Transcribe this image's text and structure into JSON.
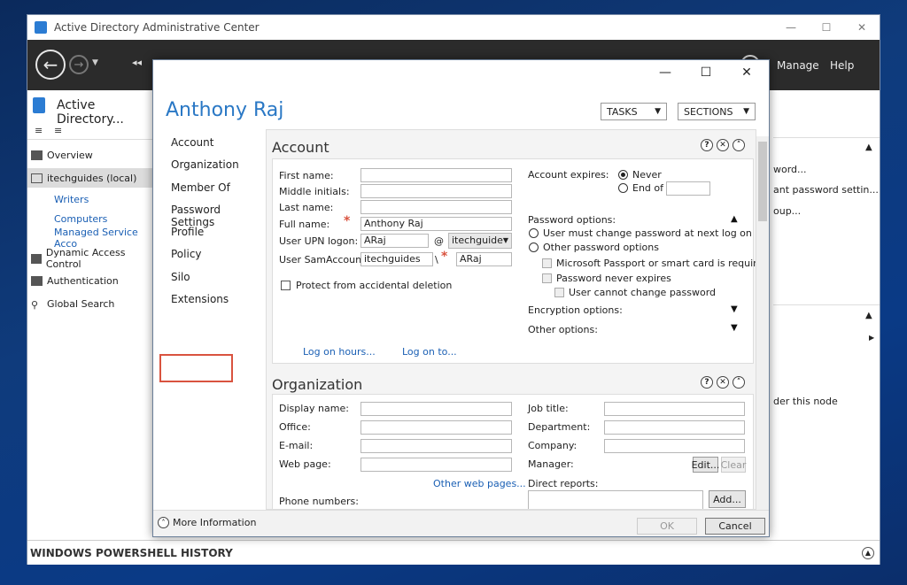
{
  "main_window": {
    "title": "Active Directory Administrative Center",
    "toolbar_breadcrumb": "◂◂",
    "toolbar_links": {
      "manage": "Manage",
      "help": "Help"
    }
  },
  "left_nav": {
    "header": "Active Directory...",
    "items": [
      {
        "label": "Overview"
      },
      {
        "label": "itechguides (local)"
      },
      {
        "label": "Writers"
      },
      {
        "label": "Computers"
      },
      {
        "label": "Managed Service Acco"
      },
      {
        "label": "Dynamic Access Control"
      },
      {
        "label": "Authentication"
      },
      {
        "label": "Global Search"
      }
    ]
  },
  "right_pane": {
    "items": [
      "word...",
      "ant password settin...",
      "oup...",
      "der this node"
    ]
  },
  "powershell_history": {
    "label": "WINDOWS POWERSHELL HISTORY"
  },
  "dialog": {
    "name": "Anthony Raj",
    "tasks_label": "TASKS",
    "sections_label": "SECTIONS",
    "sections": [
      "Account",
      "Organization",
      "Member Of",
      "Password Settings",
      "Profile",
      "Policy",
      "Silo",
      "Extensions"
    ],
    "account": {
      "title": "Account",
      "first_name_label": "First name:",
      "middle_initials_label": "Middle initials:",
      "last_name_label": "Last name:",
      "full_name_label": "Full name:",
      "full_name_value": "Anthony Raj",
      "upn_label": "User UPN logon:",
      "upn_value": "ARaj",
      "upn_at": "@",
      "upn_domain": "itechguide",
      "sam_label": "User SamAccoun...",
      "sam_domain": "itechguides",
      "sam_sep": "\\",
      "sam_value": "ARaj",
      "protect_label": "Protect from accidental deletion",
      "log_on_hours": "Log on hours...",
      "log_on_to": "Log on to...",
      "account_expires_label": "Account expires:",
      "never_label": "Never",
      "end_of_label": "End of",
      "password_options_label": "Password options:",
      "must_change_label": "User must change password at next log on",
      "other_pw_label": "Other password options",
      "passport_label": "Microsoft Passport or smart card is requir...",
      "never_expires_label": "Password never expires",
      "cannot_change_label": "User cannot change password",
      "encryption_label": "Encryption options:",
      "other_options_label": "Other options:"
    },
    "organization": {
      "title": "Organization",
      "display_name_label": "Display name:",
      "office_label": "Office:",
      "email_label": "E-mail:",
      "web_page_label": "Web page:",
      "other_web_pages": "Other web pages...",
      "phone_numbers_label": "Phone numbers:",
      "job_title_label": "Job title:",
      "department_label": "Department:",
      "company_label": "Company:",
      "manager_label": "Manager:",
      "edit_label": "Edit...",
      "clear_label": "Clear",
      "direct_reports_label": "Direct reports:",
      "add_label": "Add..."
    },
    "footer": {
      "more_info": "More Information",
      "ok_label": "OK",
      "cancel_label": "Cancel"
    }
  }
}
